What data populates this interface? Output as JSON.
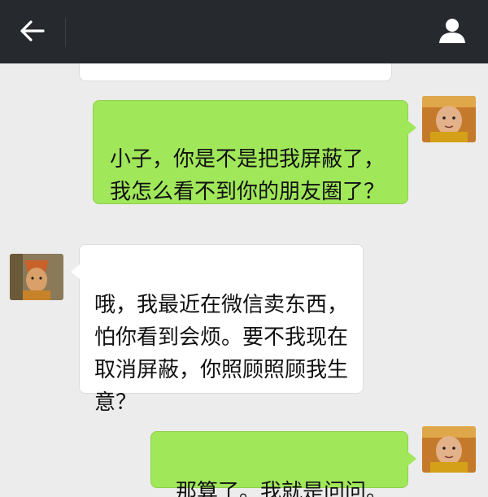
{
  "header": {
    "back_icon": "arrow-left-icon",
    "profile_icon": "person-icon"
  },
  "messages": [
    {
      "from": "me",
      "text": "小子，你是不是把我屏蔽了，\n我怎么看不到你的朋友圈了？",
      "sticker": "angry-face-sticker"
    },
    {
      "from": "other",
      "text": "哦，我最近在微信卖东西，\n怕你看到会烦。要不我现在\n取消屏蔽，你照顾照顾我生\n意？"
    },
    {
      "from": "me",
      "text": "那算了。我就是问问。"
    }
  ],
  "colors": {
    "topbar": "#262a2e",
    "background": "#ececec",
    "sent_bubble": "#a0e75a",
    "received_bubble": "#ffffff"
  }
}
